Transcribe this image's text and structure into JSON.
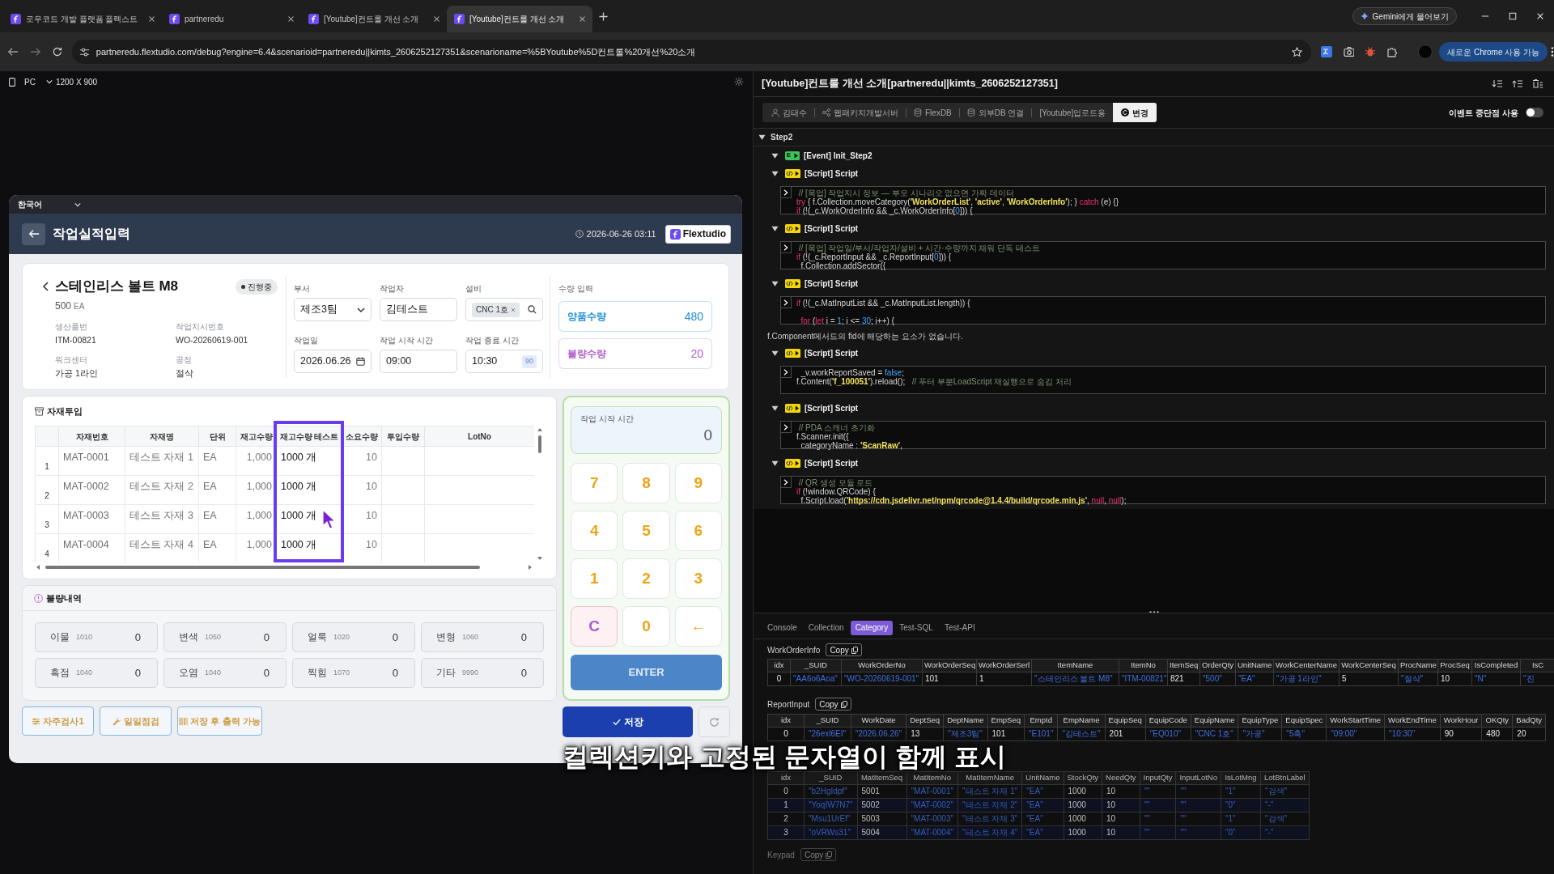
{
  "browser": {
    "tabs": [
      {
        "title": "로우코드 개발 플랫폼 플렉스트",
        "selected": false
      },
      {
        "title": "partneredu",
        "selected": false
      },
      {
        "title": "[Youtube]컨트롤 개선 소개",
        "selected": false
      },
      {
        "title": "[Youtube]컨트롤 개선 소개",
        "selected": true
      }
    ],
    "gemini_button": "Gemini에게 물어보기",
    "url": "partneredu.flextudio.com/debug?engine=6.4&scenarioid=partneredu||kimts_2606252127351&scenarioname=%5BYoutube%5D컨트롤%20개선%20소개",
    "update_button": "새로운 Chrome 사용 가능"
  },
  "preview_toolbar": {
    "device": "PC",
    "resolution": "1200 X 900"
  },
  "app": {
    "language": "한국어",
    "header": {
      "title": "작업실적입력",
      "datetime": "2026-06-26 03:11",
      "brand": "Flextudio"
    },
    "product": {
      "name": "스테인리스 볼트 M8",
      "status": "진행중",
      "quantity": "500",
      "unit": "EA",
      "details": [
        {
          "label": "생산품번",
          "value": "ITM-00821"
        },
        {
          "label": "작업지시번호",
          "value": "WO-20260619-001"
        },
        {
          "label": "워크센터",
          "value": "가공 1라인"
        },
        {
          "label": "공정",
          "value": "절삭"
        }
      ]
    },
    "form_fields": [
      {
        "label": "부서",
        "kind": "select",
        "value": "제조3팀"
      },
      {
        "label": "작업자",
        "kind": "text",
        "value": "김테스트"
      },
      {
        "label": "설비",
        "kind": "chip",
        "value": "CNC 1호"
      },
      {
        "label": "작업일",
        "kind": "date",
        "value": "2026.06.26"
      },
      {
        "label": "작업 시작 시간",
        "kind": "text",
        "value": "09:00"
      },
      {
        "label": "작업 종료 시간",
        "kind": "badge",
        "value": "10:30",
        "badge": "90"
      }
    ],
    "quantity_input": {
      "title": "수량 입력",
      "items": [
        {
          "label": "양품수량",
          "value": "480",
          "color": "#1a8fdc"
        },
        {
          "label": "불량수량",
          "value": "20",
          "color": "#b05ccc"
        }
      ]
    },
    "materials": {
      "title": "자재투입",
      "columns": [
        {
          "label": "자재번호",
          "highlighted": false
        },
        {
          "label": "자재명",
          "highlighted": false
        },
        {
          "label": "단위",
          "highlighted": false
        },
        {
          "label": "재고수량",
          "highlighted": false
        },
        {
          "label": "재고수량 테스트",
          "highlighted": true
        },
        {
          "label": "소요수량",
          "highlighted": false
        },
        {
          "label": "투입수량",
          "highlighted": false
        },
        {
          "label": "LotNo",
          "highlighted": false
        }
      ],
      "rows": [
        {
          "no": "1",
          "cells": [
            "MAT-0001",
            "테스트 자재 1",
            "EA",
            "1,000",
            "1000 개",
            "10"
          ]
        },
        {
          "no": "2",
          "cells": [
            "MAT-0002",
            "테스트 자재 2",
            "EA",
            "1,000",
            "1000 개",
            "10"
          ]
        },
        {
          "no": "3",
          "cells": [
            "MAT-0003",
            "테스트 자재 3",
            "EA",
            "1,000",
            "1000 개",
            "10"
          ]
        },
        {
          "no": "4",
          "cells": [
            "MAT-0004",
            "테스트 자재 4",
            "EA",
            "1,000",
            "1000 개",
            "10"
          ]
        }
      ]
    },
    "defects": {
      "title": "불량내역",
      "items": [
        {
          "name": "이물",
          "code": "1010",
          "count": "0"
        },
        {
          "name": "변색",
          "code": "1050",
          "count": "0"
        },
        {
          "name": "얼룩",
          "code": "1020",
          "count": "0"
        },
        {
          "name": "변형",
          "code": "1060",
          "count": "0"
        },
        {
          "name": "흑점",
          "code": "1040",
          "count": "0"
        },
        {
          "name": "오염",
          "code": "1040",
          "count": "0"
        },
        {
          "name": "찍힘",
          "code": "1070",
          "count": "0"
        },
        {
          "name": "기타",
          "code": "9990",
          "count": "0"
        }
      ]
    },
    "actions": [
      "자주검사1",
      "일일점검",
      "저장 후 출력 가능"
    ],
    "keypad": {
      "display_label": "작업 시작 시간",
      "display_value": "0",
      "keys": [
        {
          "label": "7",
          "kind": "digit"
        },
        {
          "label": "8",
          "kind": "digit"
        },
        {
          "label": "9",
          "kind": "digit"
        },
        {
          "label": "4",
          "kind": "digit"
        },
        {
          "label": "5",
          "kind": "digit"
        },
        {
          "label": "6",
          "kind": "digit"
        },
        {
          "label": "1",
          "kind": "digit"
        },
        {
          "label": "2",
          "kind": "digit"
        },
        {
          "label": "3",
          "kind": "digit"
        },
        {
          "label": "C",
          "kind": "clear"
        },
        {
          "label": "0",
          "kind": "digit"
        },
        {
          "label": "←",
          "kind": "back"
        }
      ],
      "enter": "ENTER"
    },
    "save_button": "저장"
  },
  "debugger": {
    "title": "[Youtube]컨트롤 개선 소개[partneredu||kimts_2606252127351]",
    "toolbar": [
      {
        "label": "김태수",
        "kind": "user"
      },
      {
        "label": "웹패키지개발서버",
        "kind": "server"
      },
      {
        "label": "FlexDB",
        "kind": "database"
      },
      {
        "label": "외부DB 연결",
        "kind": "database"
      },
      {
        "label": "[Youtube]업로드용",
        "kind": "plain"
      }
    ],
    "change_button": "변경",
    "breakpoints": {
      "label": "이벤트 중단점 사용",
      "on": false
    },
    "tree": {
      "label": "Step2",
      "expanded": true,
      "children": [
        {
          "kind": "event",
          "badge": "E",
          "label": "[Event] Init_Step2",
          "expanded": true
        },
        {
          "kind": "script",
          "label": "[Script] Script",
          "expanded": true,
          "code": [
            {
              "tokens": [
                {
                  "kind": "comment",
                  "text": " // [목업] 작업지시 정보 — 부모 시나리오 없으면 가짜 데이터"
                }
              ]
            },
            {
              "tokens": [
                {
                  "kind": "keyword",
                  "text": "try"
                },
                {
                  "kind": "plain",
                  "text": " { f.Collection.moveCategory("
                },
                {
                  "kind": "string",
                  "text": "'WorkOrderList'"
                },
                {
                  "kind": "plain",
                  "text": ", "
                },
                {
                  "kind": "string",
                  "text": "'active'"
                },
                {
                  "kind": "plain",
                  "text": ", "
                },
                {
                  "kind": "string",
                  "text": "'WorkOrderInfo'"
                },
                {
                  "kind": "plain",
                  "text": "); } "
                },
                {
                  "kind": "keyword",
                  "text": "catch"
                },
                {
                  "kind": "plain",
                  "text": " (e) {}"
                }
              ]
            },
            {
              "tokens": [
                {
                  "kind": "keyword",
                  "text": "if"
                },
                {
                  "kind": "plain",
                  "text": " (!(_c.WorkOrderInfo && _c.WorkOrderInfo["
                },
                {
                  "kind": "number",
                  "text": "0"
                },
                {
                  "kind": "plain",
                  "text": "])) {"
                }
              ]
            }
          ]
        },
        {
          "kind": "script",
          "label": "[Script] Script",
          "expanded": true,
          "code": [
            {
              "tokens": [
                {
                  "kind": "comment",
                  "text": " // [목업] 작업일/부서/작업자/설비 + 시간·수량까지 채워 단독 테스트"
                }
              ]
            },
            {
              "tokens": [
                {
                  "kind": "keyword",
                  "text": "if"
                },
                {
                  "kind": "plain",
                  "text": " (!(_c.ReportInput && _c.ReportInput["
                },
                {
                  "kind": "number",
                  "text": "0"
                },
                {
                  "kind": "plain",
                  "text": "])) {"
                }
              ]
            },
            {
              "tokens": [
                {
                  "kind": "plain",
                  "text": "  f.Collection.addSector({"
                }
              ]
            }
          ]
        },
        {
          "kind": "script",
          "label": "[Script] Script",
          "expanded": true,
          "code": [
            {
              "tokens": [
                {
                  "kind": "keyword",
                  "text": "if"
                },
                {
                  "kind": "plain",
                  "text": " (!(_c.MatInputList && _c.MatInputList.length)) {"
                }
              ]
            },
            {
              "spaced": true,
              "tokens": [
                {
                  "kind": "keyword",
                  "text": "  for"
                },
                {
                  "kind": "plain",
                  "text": " ("
                },
                {
                  "kind": "keyword",
                  "text": "let"
                },
                {
                  "kind": "plain",
                  "text": " i = "
                },
                {
                  "kind": "number",
                  "text": "1"
                },
                {
                  "kind": "plain",
                  "text": "; i <= "
                },
                {
                  "kind": "number",
                  "text": "30"
                },
                {
                  "kind": "plain",
                  "text": "; i++) {"
                }
              ]
            }
          ]
        },
        {
          "kind": "message",
          "text": "f.Component메서드의 fid에 해당하는 요소가 없습니다."
        },
        {
          "kind": "script",
          "label": "[Script] Script",
          "expanded": true,
          "code": [
            {
              "tokens": [
                {
                  "kind": "plain",
                  "text": "  _v.workReportSaved = "
                },
                {
                  "kind": "number",
                  "text": "false"
                },
                {
                  "kind": "plain",
                  "text": ";"
                }
              ]
            },
            {
              "tokens": [
                {
                  "kind": "plain",
                  "text": "f.Content("
                },
                {
                  "kind": "string",
                  "text": "'f_100051'"
                },
                {
                  "kind": "plain",
                  "text": ").reload();   "
                },
                {
                  "kind": "comment",
                  "text": "// 푸터 부분LoadScript 재실행으로 숨김 처리"
                }
              ]
            }
          ]
        },
        {
          "kind": "script",
          "label": "[Script] Script",
          "expanded": true,
          "code": [
            {
              "tokens": [
                {
                  "kind": "comment",
                  "text": " // PDA 스캐너 초기화"
                }
              ]
            },
            {
              "tokens": [
                {
                  "kind": "plain",
                  "text": "f.Scanner.init({"
                }
              ]
            },
            {
              "tokens": [
                {
                  "kind": "plain",
                  "text": "  categoryName : "
                },
                {
                  "kind": "string",
                  "text": "'ScanRaw'"
                },
                {
                  "kind": "plain",
                  "text": ","
                }
              ]
            }
          ]
        },
        {
          "kind": "script",
          "label": "[Script] Script",
          "expanded": true,
          "code": [
            {
              "tokens": [
                {
                  "kind": "comment",
                  "text": " // QR 생성 모듈 로드"
                }
              ]
            },
            {
              "tokens": [
                {
                  "kind": "keyword",
                  "text": "if"
                },
                {
                  "kind": "plain",
                  "text": " (!window.QRCode) {"
                }
              ]
            },
            {
              "tokens": [
                {
                  "kind": "plain",
                  "text": "  f.Script.load("
                },
                {
                  "kind": "string",
                  "text": "'https://cdn.jsdelivr.net/npm/qrcode@1.4.4/build/qrcode.min.js'"
                },
                {
                  "kind": "plain",
                  "text": ", "
                },
                {
                  "kind": "keyword",
                  "text": "null"
                },
                {
                  "kind": "plain",
                  "text": ", "
                },
                {
                  "kind": "keyword",
                  "text": "null"
                },
                {
                  "kind": "plain",
                  "text": ");"
                }
              ]
            }
          ]
        }
      ]
    },
    "console": {
      "tabs": [
        {
          "label": "Console",
          "selected": false
        },
        {
          "label": "Collection",
          "selected": false
        },
        {
          "label": "Category",
          "selected": true
        },
        {
          "label": "Test-SQL",
          "selected": false
        },
        {
          "label": "Test-API",
          "selected": false
        }
      ],
      "collections": [
        {
          "name": "WorkOrderInfo",
          "copy": "Copy",
          "columns": [
            {
              "label": "idx",
              "kind": "index"
            },
            {
              "label": "_SUID",
              "kind": "string"
            },
            {
              "label": "WorkOrderNo",
              "kind": "string"
            },
            {
              "label": "WorkOrderSeq",
              "kind": "number"
            },
            {
              "label": "WorkOrderSerl",
              "kind": "number"
            },
            {
              "label": "ItemName",
              "kind": "string"
            },
            {
              "label": "ItemNo",
              "kind": "string"
            },
            {
              "label": "ItemSeq",
              "kind": "number"
            },
            {
              "label": "OrderQty",
              "kind": "string"
            },
            {
              "label": "UnitName",
              "kind": "string"
            },
            {
              "label": "WorkCenterName",
              "kind": "string"
            },
            {
              "label": "WorkCenterSeq",
              "kind": "number"
            },
            {
              "label": "ProcName",
              "kind": "string"
            },
            {
              "label": "ProcSeq",
              "kind": "number"
            },
            {
              "label": "IsCompleted",
              "kind": "string"
            },
            {
              "label": "IsC",
              "kind": "string"
            }
          ],
          "rows": [
            [
              "0",
              "\"AA6o6Aoa\"",
              "\"WO-20260619-001\"",
              "101",
              "1",
              "\"스테인리스 볼트 M8\"",
              "\"ITM-00821\"",
              "821",
              "\"500\"",
              "\"EA\"",
              "\"가공 1라인\"",
              "5",
              "\"절삭\"",
              "10",
              "\"N\"",
              "\"진"
            ]
          ]
        },
        {
          "name": "ReportInput",
          "copy": "Copy",
          "columns": [
            {
              "label": "idx",
              "kind": "index"
            },
            {
              "label": "_SUID",
              "kind": "string"
            },
            {
              "label": "WorkDate",
              "kind": "string"
            },
            {
              "label": "DeptSeq",
              "kind": "number"
            },
            {
              "label": "DeptName",
              "kind": "string"
            },
            {
              "label": "EmpSeq",
              "kind": "number"
            },
            {
              "label": "EmpId",
              "kind": "string"
            },
            {
              "label": "EmpName",
              "kind": "string"
            },
            {
              "label": "EquipSeq",
              "kind": "number"
            },
            {
              "label": "EquipCode",
              "kind": "string"
            },
            {
              "label": "EquipName",
              "kind": "string"
            },
            {
              "label": "EquipType",
              "kind": "string"
            },
            {
              "label": "EquipSpec",
              "kind": "string"
            },
            {
              "label": "WorkStartTime",
              "kind": "string"
            },
            {
              "label": "WorkEndTime",
              "kind": "string"
            },
            {
              "label": "WorkHour",
              "kind": "number"
            },
            {
              "label": "OKQty",
              "kind": "number"
            },
            {
              "label": "BadQty",
              "kind": "number"
            }
          ],
          "rows": [
            [
              "0",
              "\"26exl6EI\"",
              "\"2026.06.26\"",
              "13",
              "\"제조3팀\"",
              "101",
              "\"E101\"",
              "\"김테스트\"",
              "201",
              "\"EQ010\"",
              "\"CNC 1호\"",
              "\"가공\"",
              "\"5축\"",
              "\"09:00\"",
              "\"10:30\"",
              "90",
              "480",
              "20"
            ]
          ]
        },
        {
          "columns": [
            {
              "label": "idx",
              "kind": "index"
            },
            {
              "label": "_SUID",
              "kind": "string"
            },
            {
              "label": "MatItemSeq",
              "kind": "number"
            },
            {
              "label": "MatItemNo",
              "kind": "string"
            },
            {
              "label": "MatItemName",
              "kind": "string"
            },
            {
              "label": "UnitName",
              "kind": "string"
            },
            {
              "label": "StockQty",
              "kind": "number"
            },
            {
              "label": "NeedQty",
              "kind": "number"
            },
            {
              "label": "InputQty",
              "kind": "string"
            },
            {
              "label": "InputLotNo",
              "kind": "string"
            },
            {
              "label": "IsLotMng",
              "kind": "string"
            },
            {
              "label": "LotBtnLabel",
              "kind": "string"
            }
          ],
          "rows": [
            [
              "0",
              "\"b2HgIdpf\"",
              "5001",
              "\"MAT-0001\"",
              "\"테스트 자재 1\"",
              "\"EA\"",
              "1000",
              "10",
              "\"\"",
              "\"\"",
              "\"1\"",
              "\"검색\""
            ],
            [
              "1",
              "\"YoqIW7N7\"",
              "5002",
              "\"MAT-0002\"",
              "\"테스트 자재 2\"",
              "\"EA\"",
              "1000",
              "10",
              "\"\"",
              "\"\"",
              "\"0\"",
              "\"-\""
            ],
            [
              "2",
              "\"Msu1UrEf\"",
              "5003",
              "\"MAT-0003\"",
              "\"테스트 자재 3\"",
              "\"EA\"",
              "1000",
              "10",
              "\"\"",
              "\"\"",
              "\"1\"",
              "\"검색\""
            ],
            [
              "3",
              "\"oVRWs31\"",
              "5004",
              "\"MAT-0004\"",
              "\"테스트 자재 4\"",
              "\"EA\"",
              "1000",
              "10",
              "\"\"",
              "\"\"",
              "\"0\"",
              "\"-\""
            ]
          ]
        },
        {
          "name": "Keypad",
          "copy": "Copy"
        }
      ]
    }
  },
  "caption": "컬렉션키와 고정된 문자열이 함께 표시"
}
